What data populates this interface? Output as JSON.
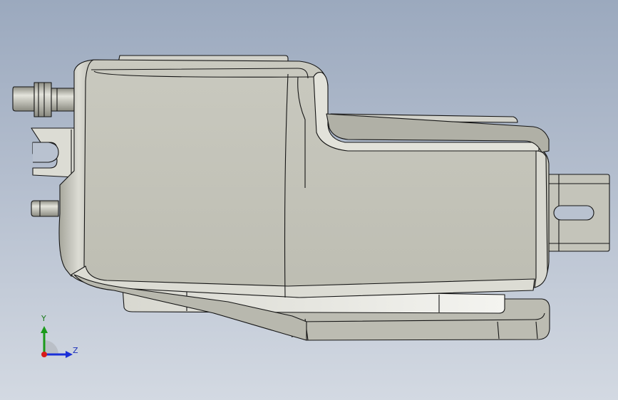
{
  "viewport": {
    "background_top": "#9ba9be",
    "background_bottom": "#d3d9e2",
    "model_color": "#c6c6bc",
    "model_shadow": "#9c9c92",
    "edge_color": "#151515"
  },
  "triad": {
    "y_label": "Y",
    "z_label": "Z",
    "y_color": "#1a9a1a",
    "z_color": "#1a2fd8",
    "x_color": "#d81a1a"
  }
}
